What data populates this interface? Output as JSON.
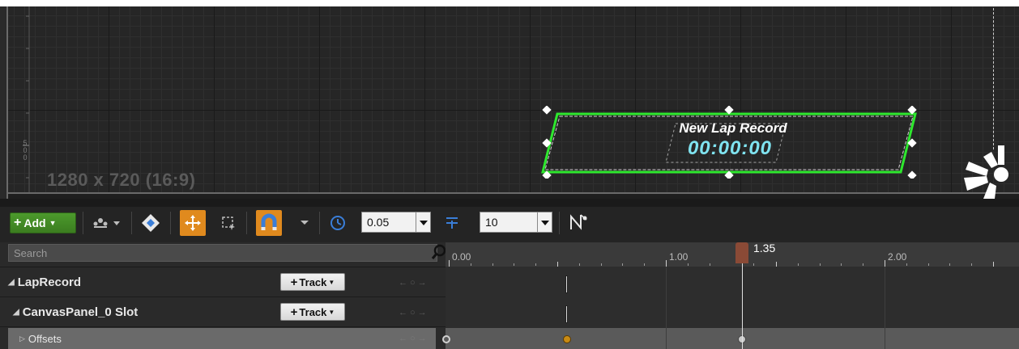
{
  "viewport": {
    "resolution_label": "1280 x 720 (16:9)",
    "ruler_label": "5\n0\n0",
    "widget": {
      "title": "New Lap Record",
      "time": "00:00:00"
    },
    "colors": {
      "selection": "#2ee82e",
      "time_text": "#7fe3f0"
    }
  },
  "toolbar": {
    "add_label": "Add",
    "snap_time": "0.05",
    "snap_value": "10",
    "colors": {
      "add_button": "#3f8a22",
      "active_tool": "#e08a1e"
    },
    "icons": [
      "visibility-dropdown-icon",
      "key-icon",
      "move-tool-icon",
      "marquee-tool-icon",
      "snap-magnet-icon",
      "clock-icon",
      "snap-value-icon",
      "curve-editor-icon"
    ]
  },
  "outliner": {
    "search_placeholder": "Search",
    "rows": [
      {
        "label": "LapRecord",
        "track_label": "Track"
      },
      {
        "label": "CanvasPanel_0 Slot",
        "track_label": "Track"
      },
      {
        "label": "Offsets"
      }
    ]
  },
  "timeline": {
    "tick_labels": [
      "0.00",
      "1.00",
      "2.00"
    ],
    "current_time": "1.35",
    "colors": {
      "scrubber": "#8a4a36",
      "keyframe": "#c98b14"
    }
  }
}
